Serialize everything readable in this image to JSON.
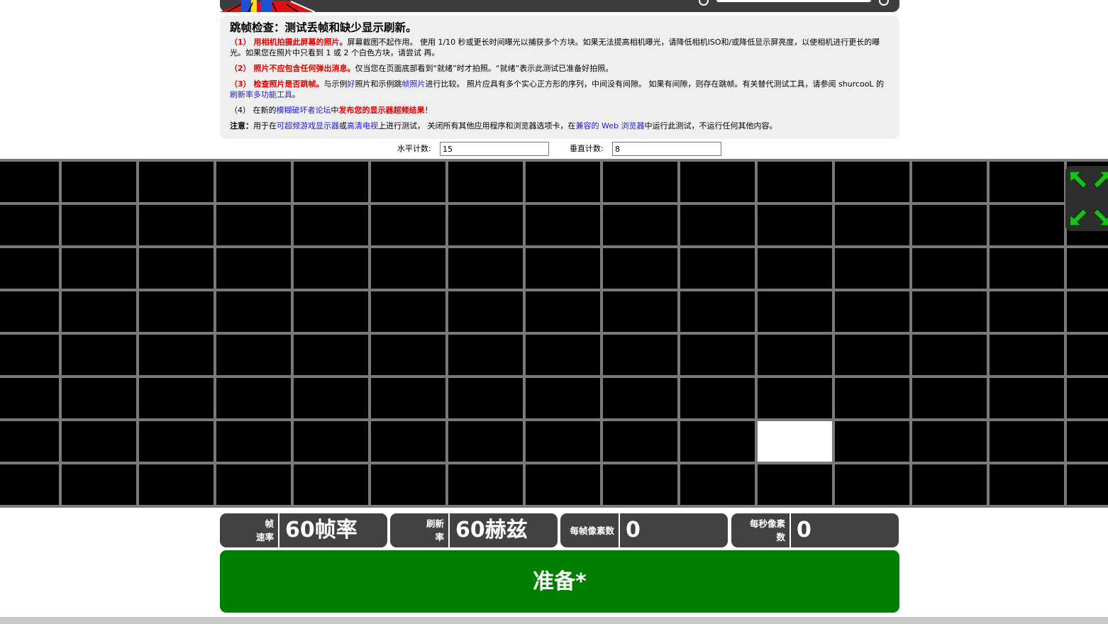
{
  "info": {
    "title": "跳帧检查：测试丢帧和缺少显示刷新。",
    "step1_lead": "（1） 用相机拍摄此屏幕的照片。",
    "step1_body": "屏幕截图不起作用。 使用 1/10 秒或更长时间曝光以捕获多个方块。如果无法提高相机曝光，请降低相机ISO和/或降低显示屏亮度，以使相机进行更长的曝光。如果您在照片中只看到 1 或 2 个白色方块，请尝试 再。",
    "step2_lead": "（2） 照片不应包含任何弹出消息。",
    "step2_body": "仅当您在页面底部看到“就绪”时才拍照。“就绪”表示此测试已准备好拍照。",
    "step3_lead": "（3） 检查照片是否跳帧。",
    "step3_t1": "与示例",
    "step3_link1": "好",
    "step3_t2": "照片和示例跳",
    "step3_link2": "帧照片",
    "step3_t3": "进行比较。 照片应具有多个实心正方形的序列，中间没有间隙。 如果有间隙，则存在跳帧。有关替代测试工具，请参阅 shurcooL 的",
    "step3_link3": "刷新率多功能工具",
    "step3_t4": "。",
    "step4_t1": "（4） 在新的",
    "step4_link1": "模糊破坏者论坛",
    "step4_t2": "中",
    "step4_red": "发布您的显示器超频结果",
    "step4_t3": "！",
    "note_lead": "注意：",
    "note_t1": "用于在",
    "note_link1": "可超频游戏显示器",
    "note_t2": "或",
    "note_link2": "高清电视",
    "note_t3": "上进行测试， 关闭所有其他应用程序和浏览器选项卡，在",
    "note_link3": "兼容的 Web 浏览器",
    "note_t4": "中运行此测试，不运行任何其他内容。"
  },
  "counts": {
    "horizontal_label": "水平计数:",
    "horizontal_value": "15",
    "vertical_label": "垂直计数:",
    "vertical_value": "8"
  },
  "grid": {
    "lit_cell": {
      "col": 10,
      "row": 6
    }
  },
  "stats": {
    "fps_label_line1": "帧",
    "fps_label_line2": "速率",
    "fps_value": "60帧率",
    "refresh_label_line1": "刷新",
    "refresh_label_line2": "率",
    "refresh_value": "60赫兹",
    "ppf_label": "每帧像素数",
    "ppf_value": "0",
    "pps_label_line1": "每秒像素",
    "pps_label_line2": "数",
    "pps_value": "0"
  },
  "status": {
    "ready_label": "准备*"
  },
  "colors": {
    "ready_bg": "#008000",
    "panel_bg": "#efefef",
    "stat_bg": "#424242",
    "grid_line": "#7a7a7a"
  }
}
